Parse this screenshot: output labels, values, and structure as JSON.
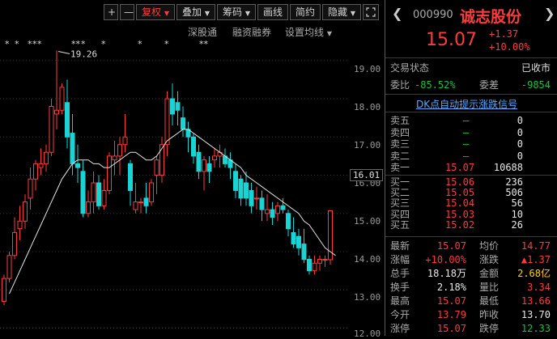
{
  "toolbar": {
    "plus": "+",
    "minus": "—",
    "fuquan": "复权",
    "diejia": "叠加",
    "chouma": "筹码",
    "huaxian": "画线",
    "jianyue": "简约",
    "yincang": "隐藏"
  },
  "subbar": {
    "shentong": "深股通",
    "rongzi": "融资融券",
    "junxian": "设置均线"
  },
  "markers": [
    "*",
    "*",
    "*",
    "*",
    "*",
    "**",
    "*",
    "*",
    "*",
    "*",
    "**"
  ],
  "yaxis": {
    "labels": [
      "19.00",
      "18.00",
      "17.00",
      "16.00",
      "15.00",
      "14.00",
      "13.00",
      "12.00"
    ],
    "current_box": "16.01"
  },
  "annotation": "19.26",
  "chart_data": {
    "type": "candlestick",
    "ylim": [
      12.0,
      19.5
    ],
    "candles": [
      {
        "o": 12.7,
        "h": 13.4,
        "l": 12.6,
        "c": 13.3
      },
      {
        "o": 13.3,
        "h": 14.0,
        "l": 13.2,
        "c": 13.9
      },
      {
        "o": 13.9,
        "h": 14.9,
        "l": 13.8,
        "c": 14.5
      },
      {
        "o": 14.6,
        "h": 15.2,
        "l": 14.3,
        "c": 14.8
      },
      {
        "o": 14.8,
        "h": 15.5,
        "l": 14.6,
        "c": 15.3
      },
      {
        "o": 15.4,
        "h": 16.2,
        "l": 15.1,
        "c": 15.9
      },
      {
        "o": 15.9,
        "h": 16.4,
        "l": 15.6,
        "c": 16.3
      },
      {
        "o": 16.2,
        "h": 16.7,
        "l": 16.0,
        "c": 16.3
      },
      {
        "o": 16.3,
        "h": 16.8,
        "l": 16.1,
        "c": 16.6
      },
      {
        "o": 16.6,
        "h": 18.0,
        "l": 16.5,
        "c": 17.8
      },
      {
        "o": 17.6,
        "h": 19.26,
        "l": 17.2,
        "c": 17.7
      },
      {
        "o": 17.7,
        "h": 18.4,
        "l": 17.6,
        "c": 18.3
      },
      {
        "o": 17.9,
        "h": 18.5,
        "l": 16.7,
        "c": 17.0
      },
      {
        "o": 17.1,
        "h": 17.6,
        "l": 16.0,
        "c": 16.3
      },
      {
        "o": 16.3,
        "h": 16.8,
        "l": 15.8,
        "c": 16.2
      },
      {
        "o": 16.1,
        "h": 16.4,
        "l": 14.9,
        "c": 15.0
      },
      {
        "o": 15.0,
        "h": 15.6,
        "l": 14.9,
        "c": 15.3
      },
      {
        "o": 15.3,
        "h": 16.1,
        "l": 15.0,
        "c": 15.8
      },
      {
        "o": 15.8,
        "h": 16.0,
        "l": 15.1,
        "c": 15.2
      },
      {
        "o": 15.2,
        "h": 15.9,
        "l": 15.1,
        "c": 15.6
      },
      {
        "o": 15.6,
        "h": 16.6,
        "l": 15.5,
        "c": 16.5
      },
      {
        "o": 16.4,
        "h": 16.9,
        "l": 16.0,
        "c": 16.5
      },
      {
        "o": 16.5,
        "h": 17.0,
        "l": 16.0,
        "c": 16.8
      },
      {
        "o": 16.8,
        "h": 17.6,
        "l": 16.6,
        "c": 17.0
      },
      {
        "o": 16.3,
        "h": 16.4,
        "l": 15.2,
        "c": 15.6
      },
      {
        "o": 15.1,
        "h": 15.8,
        "l": 15.0,
        "c": 15.3
      },
      {
        "o": 15.3,
        "h": 15.4,
        "l": 15.0,
        "c": 15.3
      },
      {
        "o": 15.4,
        "h": 15.8,
        "l": 15.0,
        "c": 15.2
      },
      {
        "o": 15.3,
        "h": 15.9,
        "l": 15.2,
        "c": 15.8
      },
      {
        "o": 16.0,
        "h": 16.5,
        "l": 15.5,
        "c": 16.4
      },
      {
        "o": 16.0,
        "h": 17.0,
        "l": 15.8,
        "c": 16.8
      },
      {
        "o": 16.8,
        "h": 18.2,
        "l": 16.5,
        "c": 18.0
      },
      {
        "o": 18.0,
        "h": 18.4,
        "l": 17.3,
        "c": 17.6
      },
      {
        "o": 17.9,
        "h": 18.2,
        "l": 17.3,
        "c": 17.7
      },
      {
        "o": 17.5,
        "h": 17.8,
        "l": 17.0,
        "c": 17.2
      },
      {
        "o": 17.2,
        "h": 17.4,
        "l": 16.6,
        "c": 17.0
      },
      {
        "o": 17.0,
        "h": 17.1,
        "l": 16.3,
        "c": 16.5
      },
      {
        "o": 16.6,
        "h": 16.8,
        "l": 15.9,
        "c": 16.1
      },
      {
        "o": 16.1,
        "h": 16.5,
        "l": 15.6,
        "c": 16.4
      },
      {
        "o": 16.3,
        "h": 16.5,
        "l": 15.8,
        "c": 16.1
      },
      {
        "o": 16.4,
        "h": 16.7,
        "l": 16.2,
        "c": 16.5
      },
      {
        "o": 16.5,
        "h": 16.8,
        "l": 16.2,
        "c": 16.6
      },
      {
        "o": 16.5,
        "h": 16.7,
        "l": 16.2,
        "c": 16.3
      },
      {
        "o": 16.4,
        "h": 16.6,
        "l": 15.9,
        "c": 16.2
      },
      {
        "o": 16.1,
        "h": 16.3,
        "l": 15.4,
        "c": 15.6
      },
      {
        "o": 15.9,
        "h": 16.0,
        "l": 15.2,
        "c": 15.4
      },
      {
        "o": 15.8,
        "h": 16.1,
        "l": 15.2,
        "c": 15.4
      },
      {
        "o": 15.6,
        "h": 15.8,
        "l": 15.0,
        "c": 15.2
      },
      {
        "o": 15.4,
        "h": 15.7,
        "l": 15.1,
        "c": 15.4
      },
      {
        "o": 15.4,
        "h": 15.6,
        "l": 14.8,
        "c": 15.1
      },
      {
        "o": 15.0,
        "h": 15.5,
        "l": 14.8,
        "c": 15.1
      },
      {
        "o": 15.1,
        "h": 15.3,
        "l": 14.7,
        "c": 14.9
      },
      {
        "o": 15.0,
        "h": 15.3,
        "l": 14.8,
        "c": 15.2
      },
      {
        "o": 15.2,
        "h": 15.4,
        "l": 15.0,
        "c": 15.1
      },
      {
        "o": 15.0,
        "h": 15.1,
        "l": 14.4,
        "c": 14.6
      },
      {
        "o": 14.5,
        "h": 14.9,
        "l": 14.1,
        "c": 14.2
      },
      {
        "o": 14.4,
        "h": 14.6,
        "l": 13.9,
        "c": 14.1
      },
      {
        "o": 14.2,
        "h": 14.6,
        "l": 13.7,
        "c": 13.8
      },
      {
        "o": 13.8,
        "h": 13.9,
        "l": 13.4,
        "c": 13.5
      },
      {
        "o": 13.5,
        "h": 13.9,
        "l": 13.4,
        "c": 13.7
      },
      {
        "o": 13.7,
        "h": 13.9,
        "l": 13.5,
        "c": 13.8
      },
      {
        "o": 13.8,
        "h": 13.9,
        "l": 13.6,
        "c": 13.8
      },
      {
        "o": 13.79,
        "h": 15.07,
        "l": 13.66,
        "c": 15.07
      }
    ],
    "ma": [
      12.9,
      13.2,
      13.5,
      13.8,
      14.1,
      14.4,
      14.7,
      15.0,
      15.3,
      15.6,
      15.9,
      16.1,
      16.3,
      16.4,
      16.4,
      16.4,
      16.3,
      16.3,
      16.2,
      16.2,
      16.3,
      16.4,
      16.5,
      16.6,
      16.6,
      16.5,
      16.4,
      16.4,
      16.5,
      16.7,
      16.9,
      17.0,
      17.1,
      17.2,
      17.2,
      17.1,
      17.0,
      16.9,
      16.8,
      16.7,
      16.6,
      16.5,
      16.4,
      16.3,
      16.2,
      16.0,
      15.9,
      15.8,
      15.7,
      15.6,
      15.5,
      15.4,
      15.3,
      15.2,
      15.1,
      15.0,
      14.8,
      14.7,
      14.5,
      14.3,
      14.1,
      14.0,
      13.9
    ]
  },
  "stock": {
    "code": "000990",
    "name": "诚志股份",
    "price": "15.07",
    "change": "+1.37",
    "pct": "+10.00%"
  },
  "status": {
    "label": "交易状态",
    "value": "已收市"
  },
  "ratio": {
    "wb_label": "委比",
    "wb_value": "-85.52%",
    "wc_label": "委差",
    "wc_value": "-9854"
  },
  "signal_link": "DK点自动提示涨跌信号",
  "sell": [
    {
      "label": "卖五",
      "price": "—",
      "vol": "0"
    },
    {
      "label": "卖四",
      "price": "—",
      "vol": "0"
    },
    {
      "label": "卖三",
      "price": "—",
      "vol": "0"
    },
    {
      "label": "卖二",
      "price": "—",
      "vol": "0"
    },
    {
      "label": "卖一",
      "price": "15.07",
      "vol": "10688"
    }
  ],
  "buy": [
    {
      "label": "买一",
      "price": "15.06",
      "vol": "236"
    },
    {
      "label": "买二",
      "price": "15.05",
      "vol": "506"
    },
    {
      "label": "买三",
      "price": "15.04",
      "vol": "56"
    },
    {
      "label": "买四",
      "price": "15.03",
      "vol": "10"
    },
    {
      "label": "买五",
      "price": "15.02",
      "vol": "26"
    }
  ],
  "stats": [
    {
      "l1": "最新",
      "v1": "15.07",
      "c1": "red",
      "l2": "均价",
      "v2": "14.77",
      "c2": "red"
    },
    {
      "l1": "涨幅",
      "v1": "+10.00%",
      "c1": "red",
      "l2": "涨跌",
      "v2": "▲1.37",
      "c2": "red"
    },
    {
      "l1": "总手",
      "v1": "18.18万",
      "c1": "white",
      "l2": "金额",
      "v2": "2.68亿",
      "c2": "yellow"
    },
    {
      "l1": "换手",
      "v1": "2.18%",
      "c1": "white",
      "l2": "量比",
      "v2": "3.34",
      "c2": "red"
    },
    {
      "l1": "最高",
      "v1": "15.07",
      "c1": "red",
      "l2": "最低",
      "v2": "13.66",
      "c2": "red"
    },
    {
      "l1": "今开",
      "v1": "13.79",
      "c1": "red",
      "l2": "昨收",
      "v2": "13.70",
      "c2": "white"
    },
    {
      "l1": "涨停",
      "v1": "15.07",
      "c1": "red",
      "l2": "跌停",
      "v2": "12.33",
      "c2": "green"
    }
  ]
}
